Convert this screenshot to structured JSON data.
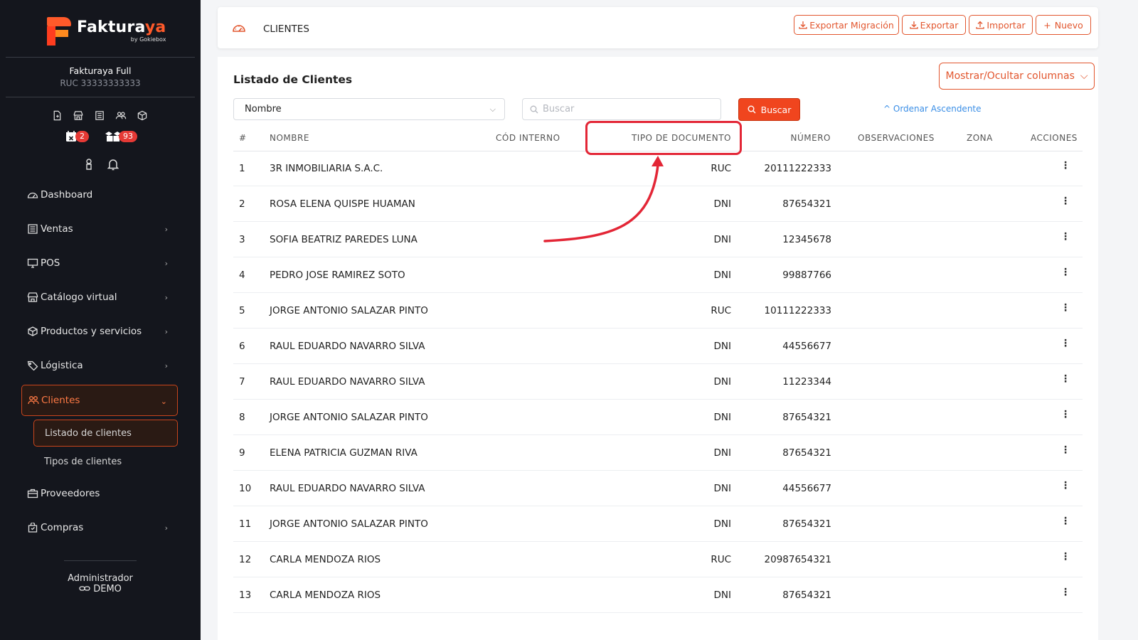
{
  "brand": {
    "name_main": "Faktura",
    "name_accent": "ya",
    "by": "by Gokiebox"
  },
  "company": {
    "name": "Fakturaya Full",
    "ruc": "RUC 33333333333"
  },
  "badges": {
    "calendar": "2",
    "boxes": "93"
  },
  "nav": [
    {
      "label": "Dashboard",
      "icon": "dashboard-icon",
      "chevron": false
    },
    {
      "label": "Ventas",
      "icon": "receipt-icon",
      "chevron": true
    },
    {
      "label": "POS",
      "icon": "monitor-icon",
      "chevron": true
    },
    {
      "label": "Catálogo virtual",
      "icon": "store-icon",
      "chevron": true
    },
    {
      "label": "Productos y servicios",
      "icon": "box-icon",
      "chevron": true
    },
    {
      "label": "Lógistica",
      "icon": "tag-icon",
      "chevron": true
    },
    {
      "label": "Clientes",
      "icon": "users-icon",
      "chevron": true
    },
    {
      "label": "Proveedores",
      "icon": "briefcase-icon",
      "chevron": false
    },
    {
      "label": "Compras",
      "icon": "bag-icon",
      "chevron": true
    }
  ],
  "subnav": [
    {
      "label": "Listado de clientes"
    },
    {
      "label": "Tipos de clientes"
    }
  ],
  "admin": {
    "role": "Administrador",
    "user": "DEMO"
  },
  "topbar": {
    "title": "CLIENTES",
    "buttons": {
      "export_migration": "Exportar Migración",
      "export": "Exportar",
      "import": "Importar",
      "new": "Nuevo"
    }
  },
  "list": {
    "title": "Listado de Clientes",
    "columns_button": "Mostrar/Ocultar columnas",
    "filter_select": "Nombre",
    "search_placeholder": "Buscar",
    "search_button": "Buscar",
    "order_label": "Ordenar Ascendente"
  },
  "table": {
    "headers": {
      "index": "#",
      "name": "NOMBRE",
      "code": "CÓD INTERNO",
      "doc_type": "TIPO DE DOCUMENTO",
      "number": "NÚMERO",
      "notes": "OBSERVACIONES",
      "zone": "ZONA",
      "actions": "ACCIONES"
    },
    "rows": [
      {
        "i": "1",
        "name": "3R INMOBILIARIA S.A.C.",
        "doc": "RUC",
        "num": "20111222333"
      },
      {
        "i": "2",
        "name": "ROSA ELENA QUISPE HUAMAN",
        "doc": "DNI",
        "num": "87654321"
      },
      {
        "i": "3",
        "name": "SOFIA BEATRIZ PAREDES LUNA",
        "doc": "DNI",
        "num": "12345678"
      },
      {
        "i": "4",
        "name": "PEDRO JOSE RAMIREZ SOTO",
        "doc": "DNI",
        "num": "99887766"
      },
      {
        "i": "5",
        "name": "JORGE ANTONIO SALAZAR PINTO",
        "doc": "RUC",
        "num": "10111222333"
      },
      {
        "i": "6",
        "name": "RAUL EDUARDO NAVARRO SILVA",
        "doc": "DNI",
        "num": "44556677"
      },
      {
        "i": "7",
        "name": "RAUL EDUARDO NAVARRO SILVA",
        "doc": "DNI",
        "num": "11223344"
      },
      {
        "i": "8",
        "name": "JORGE ANTONIO SALAZAR PINTO",
        "doc": "DNI",
        "num": "87654321"
      },
      {
        "i": "9",
        "name": "ELENA PATRICIA GUZMAN RIVA",
        "doc": "DNI",
        "num": "87654321"
      },
      {
        "i": "10",
        "name": "RAUL EDUARDO NAVARRO SILVA",
        "doc": "DNI",
        "num": "44556677"
      },
      {
        "i": "11",
        "name": "JORGE ANTONIO SALAZAR PINTO",
        "doc": "DNI",
        "num": "87654321"
      },
      {
        "i": "12",
        "name": "CARLA MENDOZA RIOS",
        "doc": "RUC",
        "num": "20987654321"
      },
      {
        "i": "13",
        "name": "CARLA MENDOZA RIOS",
        "doc": "DNI",
        "num": "87654321"
      }
    ]
  },
  "colors": {
    "accent": "#e2562e",
    "sidebar_bg": "#14161d",
    "highlight": "#e32636",
    "link": "#3a8ee6"
  }
}
